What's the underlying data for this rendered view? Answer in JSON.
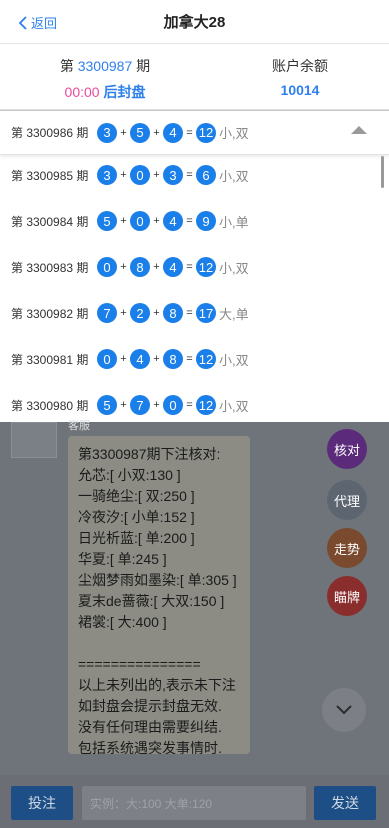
{
  "header": {
    "back_label": "返回",
    "title": "加拿大28"
  },
  "info": {
    "period_prefix": "第",
    "period_number": "3300987",
    "period_suffix": "期",
    "timer": "00:00",
    "status": "后封盘",
    "balance_label": "账户余额",
    "balance_value": "10014"
  },
  "latest": {
    "label": "第 3300986 期",
    "n1": "3",
    "n2": "5",
    "n3": "4",
    "sum": "12",
    "tag": "小,双"
  },
  "results": [
    {
      "label": "第 3300985 期",
      "n1": "3",
      "n2": "0",
      "n3": "3",
      "sum": "6",
      "tag": "小,双"
    },
    {
      "label": "第 3300984 期",
      "n1": "5",
      "n2": "0",
      "n3": "4",
      "sum": "9",
      "tag": "小,单"
    },
    {
      "label": "第 3300983 期",
      "n1": "0",
      "n2": "8",
      "n3": "4",
      "sum": "12",
      "tag": "小,双"
    },
    {
      "label": "第 3300982 期",
      "n1": "7",
      "n2": "2",
      "n3": "8",
      "sum": "17",
      "tag": "大,单"
    },
    {
      "label": "第 3300981 期",
      "n1": "0",
      "n2": "4",
      "n3": "8",
      "sum": "12",
      "tag": "小,双"
    },
    {
      "label": "第 3300980 期",
      "n1": "5",
      "n2": "7",
      "n3": "0",
      "sum": "12",
      "tag": "小,双"
    }
  ],
  "ops": {
    "plus": "+",
    "equals": "="
  },
  "chat": {
    "sender": "客服",
    "message": "第3300987期下注核对:\n允芯:[ 小双:130 ]\n一骑绝尘:[ 双:250 ]\n冷夜汐:[ 小单:152 ]\n日光析蓝:[ 单:200 ]\n华夏:[ 单:245 ]\n尘烟梦雨如墨染:[ 单:305 ]\n夏末de蔷薇:[ 大双:150 ]\n裙裳:[ 大:400 ]\n\n===============\n以上未列出的,表示未下注\n如封盘会提示封盘无效.\n没有任何理由需要纠结.\n包括系统遇突发事情时."
  },
  "fabs": {
    "check": "核对",
    "agent": "代理",
    "trend": "走势",
    "cards": "瞄牌"
  },
  "bottom": {
    "bet_label": "投注",
    "input_placeholder": "实例：大:100 大单:120",
    "send_label": "发送"
  }
}
